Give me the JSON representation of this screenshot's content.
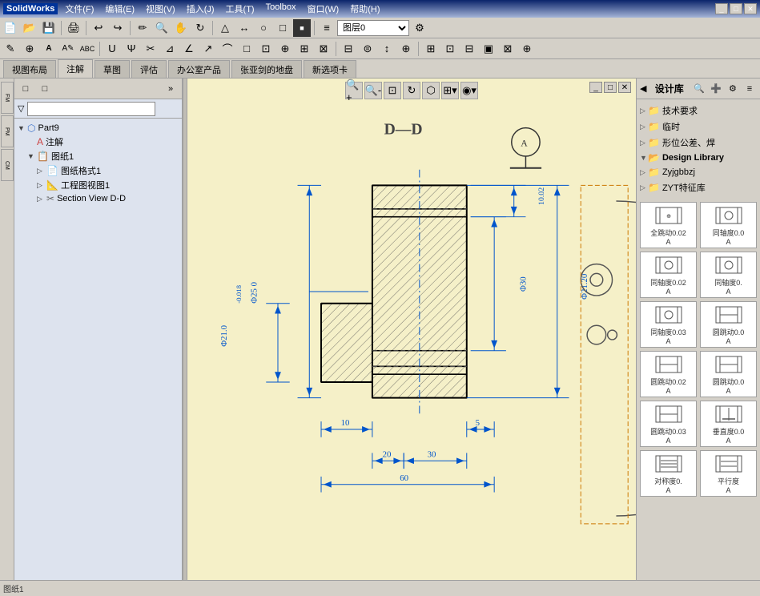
{
  "titlebar": {
    "logo": "SolidWorks",
    "menus": [
      "文件(F)",
      "编辑(E)",
      "视图(V)",
      "插入(J)",
      "工具(T)",
      "Toolbox",
      "窗口(W)",
      "帮助(H)"
    ]
  },
  "toolbars": {
    "layer_select": "图层0",
    "toolbar2_buttons": [
      "new",
      "open",
      "save",
      "print",
      "undo",
      "redo",
      "select",
      "sketch",
      "dimension",
      "note",
      "layer"
    ]
  },
  "tabs": {
    "items": [
      "视图布局",
      "注解",
      "草图",
      "评估",
      "办公室产品",
      "张亚剑的地盘",
      "新选项卡"
    ]
  },
  "left_panel": {
    "tree_items": [
      {
        "label": "Part9",
        "level": 0,
        "expanded": true,
        "icon": "part"
      },
      {
        "label": "注解",
        "level": 1,
        "icon": "annotation"
      },
      {
        "label": "图纸1",
        "level": 1,
        "expanded": true,
        "icon": "sheet"
      },
      {
        "label": "图纸格式1",
        "level": 2,
        "expanded": false,
        "icon": "sheetformat"
      },
      {
        "label": "工程图视图1",
        "level": 2,
        "expanded": false,
        "icon": "drawingview"
      },
      {
        "label": "Section View D-D",
        "level": 2,
        "expanded": false,
        "icon": "section"
      }
    ]
  },
  "drawing": {
    "section_label": "D—D",
    "circle_label": "A"
  },
  "right_panel": {
    "title": "设计库",
    "collapse_icon": "◀",
    "tree_items": [
      {
        "label": "技术要求",
        "level": 0,
        "expanded": false
      },
      {
        "label": "临时",
        "level": 0,
        "expanded": false
      },
      {
        "label": "形位公差、焊",
        "level": 0,
        "expanded": false
      },
      {
        "label": "Design Library",
        "level": 0,
        "expanded": true
      },
      {
        "label": "Zyjgbbzj",
        "level": 0,
        "expanded": false
      },
      {
        "label": "ZYT特征库",
        "level": 0,
        "expanded": false
      }
    ],
    "symbols": [
      {
        "label": "全跳动0.02\nA",
        "sublabel": "同轴度0.0\nA"
      },
      {
        "label": "同轴度0.02\nA",
        "sublabel": "同轴度0.\nA"
      },
      {
        "label": "同轴度0.03\nA",
        "sublabel": "圆跳动0.0\nA"
      },
      {
        "label": "圆跳动0.02\nA",
        "sublabel": "圆跳动0.0\nA"
      },
      {
        "label": "圆跳动0.03\nA",
        "sublabel": "垂直度0.0\nA"
      },
      {
        "label": "对称度0.\nA",
        "sublabel": "平行度\nA"
      }
    ]
  },
  "statusbar": {
    "text": "图纸1"
  }
}
